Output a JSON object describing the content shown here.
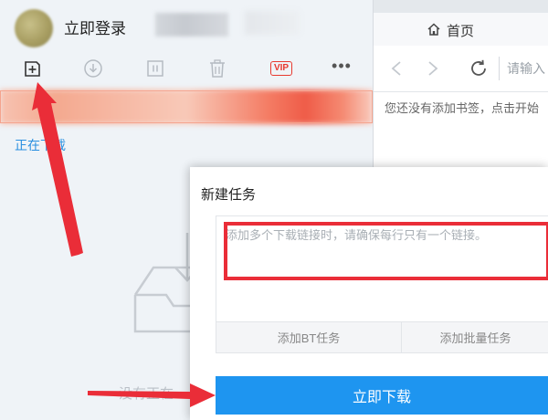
{
  "account": {
    "login_label": "立即登录"
  },
  "toolbar": {
    "vip_label": "VIP",
    "more_label": "•••"
  },
  "left_panel": {
    "downloading_label": "正在下载",
    "empty_text": "没有正在"
  },
  "browser": {
    "tab_label": "首页",
    "url_placeholder": "请输入",
    "bookmark_hint": "您还没有添加书签，点击开始"
  },
  "dialog": {
    "title": "新建任务",
    "link_placeholder": "添加多个下载链接时，请确保每行只有一个链接。",
    "bt_task_label": "添加BT任务",
    "batch_task_label": "添加批量任务",
    "download_now_label": "立即下载"
  },
  "colors": {
    "accent_blue": "#1e95f0",
    "link_blue": "#2a8fe0",
    "annotation_red": "#ea2d38"
  }
}
